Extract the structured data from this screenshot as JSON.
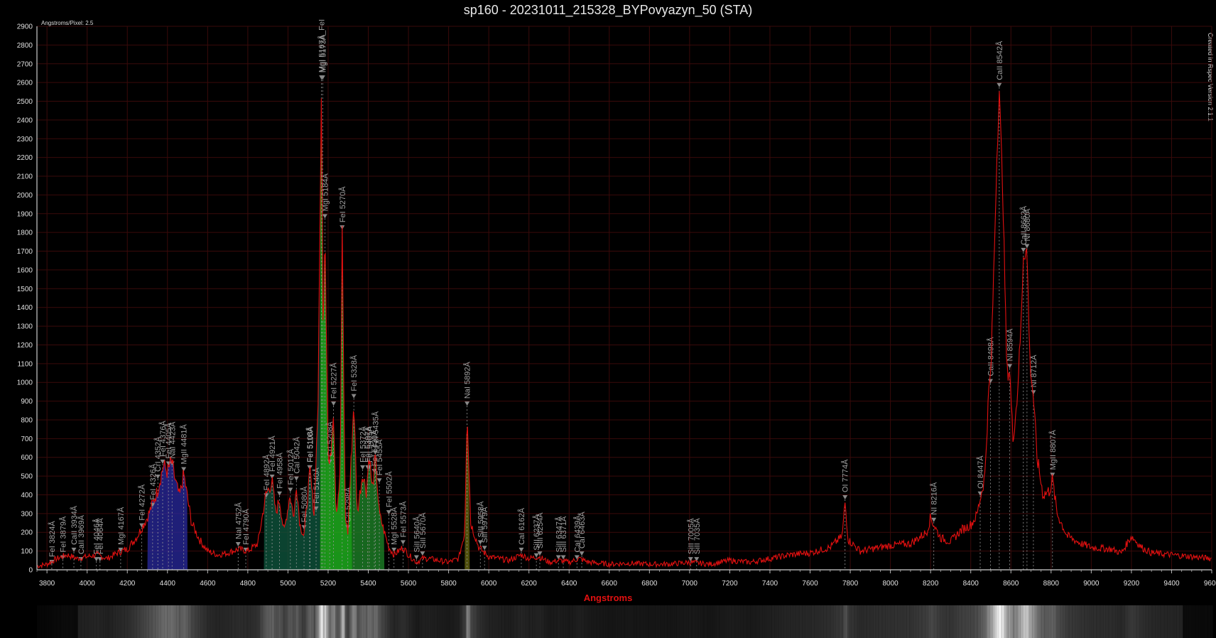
{
  "window": {
    "title": "sp160 - 20231011_215328_BYPovyazyn_50 (STA)",
    "angstroms_per_pixel": "Angstroms/Pixel: 2.5",
    "credit": "Created in Rspec Version 2.1.1"
  },
  "colors": {
    "background": "#000000",
    "grid": "#3a0a0a",
    "line": "#e21010",
    "marker": "#888888",
    "label": "#a0a0a0",
    "axis_label": "#e21010"
  },
  "chart_data": {
    "type": "line",
    "title": "sp160 - 20231011_215328_BYPovyazyn_50 (STA)",
    "xlabel": "Angstroms",
    "ylabel": "",
    "xlim": [
      3750,
      9600
    ],
    "ylim": [
      0,
      2900
    ],
    "x_ticks": [
      3800,
      4000,
      4200,
      4400,
      4600,
      4800,
      5000,
      5200,
      5400,
      5600,
      5800,
      6000,
      6200,
      6400,
      6600,
      6800,
      7000,
      7200,
      7400,
      7600,
      7800,
      8000,
      8200,
      8400,
      8600,
      8800,
      9000,
      9200,
      9400,
      9600
    ],
    "y_ticks": [
      0,
      100,
      200,
      300,
      400,
      500,
      600,
      700,
      800,
      900,
      1000,
      1100,
      1200,
      1300,
      1400,
      1500,
      1600,
      1700,
      1800,
      1900,
      2000,
      2100,
      2200,
      2300,
      2400,
      2500,
      2600,
      2700,
      2800,
      2900
    ],
    "grid": true,
    "series": [
      {
        "values": [
          [
            3750,
            20
          ],
          [
            3800,
            30
          ],
          [
            3850,
            60
          ],
          [
            3900,
            80
          ],
          [
            3950,
            60
          ],
          [
            4000,
            70
          ],
          [
            4050,
            80
          ],
          [
            4100,
            60
          ],
          [
            4150,
            90
          ],
          [
            4200,
            110
          ],
          [
            4250,
            180
          ],
          [
            4300,
            280
          ],
          [
            4350,
            420
          ],
          [
            4380,
            560
          ],
          [
            4400,
            520
          ],
          [
            4420,
            580
          ],
          [
            4440,
            470
          ],
          [
            4460,
            390
          ],
          [
            4481,
            510
          ],
          [
            4520,
            250
          ],
          [
            4560,
            160
          ],
          [
            4600,
            100
          ],
          [
            4650,
            80
          ],
          [
            4700,
            90
          ],
          [
            4752,
            110
          ],
          [
            4800,
            100
          ],
          [
            4850,
            140
          ],
          [
            4890,
            400
          ],
          [
            4921,
            470
          ],
          [
            4940,
            300
          ],
          [
            4957,
            380
          ],
          [
            4980,
            200
          ],
          [
            5010,
            400
          ],
          [
            5030,
            280
          ],
          [
            5042,
            460
          ],
          [
            5060,
            240
          ],
          [
            5080,
            180
          ],
          [
            5100,
            420
          ],
          [
            5110,
            520
          ],
          [
            5130,
            300
          ],
          [
            5150,
            900
          ],
          [
            5167,
            2600
          ],
          [
            5175,
            1200
          ],
          [
            5184,
            1860
          ],
          [
            5200,
            600
          ],
          [
            5208,
            550
          ],
          [
            5227,
            860
          ],
          [
            5240,
            300
          ],
          [
            5260,
            500
          ],
          [
            5270,
            1800
          ],
          [
            5285,
            300
          ],
          [
            5298,
            200
          ],
          [
            5328,
            900
          ],
          [
            5345,
            300
          ],
          [
            5372,
            520
          ],
          [
            5390,
            420
          ],
          [
            5405,
            620
          ],
          [
            5420,
            420
          ],
          [
            5435,
            600
          ],
          [
            5455,
            300
          ],
          [
            5480,
            200
          ],
          [
            5502,
            120
          ],
          [
            5528,
            80
          ],
          [
            5573,
            120
          ],
          [
            5600,
            80
          ],
          [
            5640,
            40
          ],
          [
            5670,
            60
          ],
          [
            5700,
            60
          ],
          [
            5750,
            50
          ],
          [
            5800,
            40
          ],
          [
            5850,
            60
          ],
          [
            5880,
            200
          ],
          [
            5892,
            860
          ],
          [
            5900,
            600
          ],
          [
            5910,
            250
          ],
          [
            5950,
            120
          ],
          [
            5979,
            90
          ],
          [
            6000,
            70
          ],
          [
            6050,
            60
          ],
          [
            6100,
            50
          ],
          [
            6162,
            80
          ],
          [
            6200,
            60
          ],
          [
            6250,
            70
          ],
          [
            6300,
            40
          ],
          [
            6350,
            50
          ],
          [
            6400,
            40
          ],
          [
            6450,
            60
          ],
          [
            6500,
            40
          ],
          [
            6600,
            30
          ],
          [
            6700,
            35
          ],
          [
            6800,
            30
          ],
          [
            6900,
            30
          ],
          [
            7000,
            40
          ],
          [
            7100,
            30
          ],
          [
            7200,
            50
          ],
          [
            7300,
            40
          ],
          [
            7400,
            60
          ],
          [
            7500,
            80
          ],
          [
            7600,
            90
          ],
          [
            7700,
            120
          ],
          [
            7760,
            180
          ],
          [
            7774,
            360
          ],
          [
            7790,
            160
          ],
          [
            7850,
            100
          ],
          [
            7900,
            110
          ],
          [
            8000,
            130
          ],
          [
            8100,
            140
          ],
          [
            8180,
            200
          ],
          [
            8200,
            280
          ],
          [
            8216,
            240
          ],
          [
            8250,
            170
          ],
          [
            8300,
            150
          ],
          [
            8350,
            210
          ],
          [
            8400,
            240
          ],
          [
            8430,
            290
          ],
          [
            8447,
            380
          ],
          [
            8470,
            500
          ],
          [
            8490,
            960
          ],
          [
            8500,
            1050
          ],
          [
            8520,
            1800
          ],
          [
            8530,
            2200
          ],
          [
            8542,
            2560
          ],
          [
            8560,
            2000
          ],
          [
            8580,
            1050
          ],
          [
            8594,
            1060
          ],
          [
            8610,
            700
          ],
          [
            8630,
            900
          ],
          [
            8650,
            1300
          ],
          [
            8662,
            1680
          ],
          [
            8675,
            1700
          ],
          [
            8680,
            1700
          ],
          [
            8695,
            1100
          ],
          [
            8712,
            920
          ],
          [
            8730,
            600
          ],
          [
            8760,
            400
          ],
          [
            8790,
            420
          ],
          [
            8807,
            480
          ],
          [
            8830,
            300
          ],
          [
            8880,
            180
          ],
          [
            8950,
            140
          ],
          [
            9000,
            120
          ],
          [
            9100,
            110
          ],
          [
            9150,
            90
          ],
          [
            9200,
            180
          ],
          [
            9250,
            120
          ],
          [
            9300,
            90
          ],
          [
            9400,
            80
          ],
          [
            9500,
            70
          ],
          [
            9600,
            60
          ]
        ]
      }
    ],
    "annotations": [
      {
        "label": "FeI 3824Å",
        "x": 3824,
        "y": 15
      },
      {
        "label": "FeI 3879Å",
        "x": 3879,
        "y": 40
      },
      {
        "label": "CaII 3934Å",
        "x": 3934,
        "y": 80
      },
      {
        "label": "CaII 3969Å",
        "x": 3969,
        "y": 30
      },
      {
        "label": "FeI 4046Å",
        "x": 4046,
        "y": 30
      },
      {
        "label": "FeI 4064Å",
        "x": 4064,
        "y": 30
      },
      {
        "label": "MgI 4167Å",
        "x": 4167,
        "y": 80
      },
      {
        "label": "FeI 4272Å",
        "x": 4272,
        "y": 210
      },
      {
        "label": "FeI 4326Å",
        "x": 4326,
        "y": 320
      },
      {
        "label": "CrI 4352Å",
        "x": 4352,
        "y": 470
      },
      {
        "label": "FeI 4376Å",
        "x": 4376,
        "y": 550
      },
      {
        "label": "FeI 4405Å",
        "x": 4405,
        "y": 540
      },
      {
        "label": "NaI 4423Å",
        "x": 4423,
        "y": 540
      },
      {
        "label": "MgII 4481Å",
        "x": 4481,
        "y": 510
      },
      {
        "label": "NaI 4752Å",
        "x": 4752,
        "y": 110
      },
      {
        "label": "FeI 4790Å",
        "x": 4790,
        "y": 80
      },
      {
        "label": "FeI 4892Å",
        "x": 4892,
        "y": 370
      },
      {
        "label": "FeI 4921Å",
        "x": 4921,
        "y": 470
      },
      {
        "label": "FeI 4958Å",
        "x": 4958,
        "y": 380
      },
      {
        "label": "FeI 5012Å",
        "x": 5012,
        "y": 400
      },
      {
        "label": "CaI 5042Å",
        "x": 5042,
        "y": 460
      },
      {
        "label": "FeI 5080Å",
        "x": 5080,
        "y": 200
      },
      {
        "label": "FeI 5108Å",
        "x": 5108,
        "y": 520
      },
      {
        "label": "FeI 5110Å",
        "x": 5110,
        "y": 520
      },
      {
        "label": "FeI 5140Å",
        "x": 5140,
        "y": 300
      },
      {
        "label": "MgI 5167Å_FeI",
        "x": 5167,
        "y": 2600
      },
      {
        "label": "MgI 5173Å",
        "x": 5173,
        "y": 2600
      },
      {
        "label": "MgI 5184Å",
        "x": 5184,
        "y": 1860
      },
      {
        "label": "CrI 5208Å",
        "x": 5208,
        "y": 550
      },
      {
        "label": "FeI 5227Å",
        "x": 5227,
        "y": 860
      },
      {
        "label": "FeI 5270Å",
        "x": 5270,
        "y": 1800
      },
      {
        "label": "CrI 5298Å",
        "x": 5298,
        "y": 200
      },
      {
        "label": "FeI 5328Å",
        "x": 5328,
        "y": 900
      },
      {
        "label": "FeI 5372Å",
        "x": 5372,
        "y": 520
      },
      {
        "label": "FeI 5397Å",
        "x": 5397,
        "y": 520
      },
      {
        "label": "FeI 5405Å",
        "x": 5405,
        "y": 520
      },
      {
        "label": "FeI 5430Å",
        "x": 5430,
        "y": 500
      },
      {
        "label": "FeI 5435Å",
        "x": 5435,
        "y": 600
      },
      {
        "label": "FeI 5455Å",
        "x": 5455,
        "y": 450
      },
      {
        "label": "FeI 5502Å",
        "x": 5502,
        "y": 280
      },
      {
        "label": "MgI 5528Å",
        "x": 5528,
        "y": 80
      },
      {
        "label": "FeI 5573Å",
        "x": 5573,
        "y": 120
      },
      {
        "label": "SiII 5640Å",
        "x": 5640,
        "y": 40
      },
      {
        "label": "SiII 5670Å",
        "x": 5670,
        "y": 60
      },
      {
        "label": "NaI 5892Å",
        "x": 5892,
        "y": 860
      },
      {
        "label": "SiII 5958Å",
        "x": 5958,
        "y": 120
      },
      {
        "label": "SiII 5979Å",
        "x": 5979,
        "y": 90
      },
      {
        "label": "CaI 6162Å",
        "x": 6162,
        "y": 80
      },
      {
        "label": "SiII 6237Å",
        "x": 6237,
        "y": 50
      },
      {
        "label": "SiII 6254Å",
        "x": 6254,
        "y": 60
      },
      {
        "label": "SiII 6347Å",
        "x": 6347,
        "y": 40
      },
      {
        "label": "SiII 6371Å",
        "x": 6371,
        "y": 40
      },
      {
        "label": "CaI 6439Å",
        "x": 6439,
        "y": 40
      },
      {
        "label": "CaI 6463Å",
        "x": 6463,
        "y": 60
      },
      {
        "label": "SiII 7005Å",
        "x": 7005,
        "y": 30
      },
      {
        "label": "SiII 7035Å",
        "x": 7035,
        "y": 30
      },
      {
        "label": "OI 7774Å",
        "x": 7774,
        "y": 360
      },
      {
        "label": "NI 8216Å",
        "x": 8216,
        "y": 240
      },
      {
        "label": "OI 8447Å",
        "x": 8447,
        "y": 380
      },
      {
        "label": "CaII 8498Å",
        "x": 8498,
        "y": 980
      },
      {
        "label": "CaII 8542Å",
        "x": 8542,
        "y": 2560
      },
      {
        "label": "NI 8594Å",
        "x": 8594,
        "y": 1060
      },
      {
        "label": "CaII 8662Å",
        "x": 8662,
        "y": 1680
      },
      {
        "label": "NI 8680Å",
        "x": 8680,
        "y": 1700
      },
      {
        "label": "NI 8712Å",
        "x": 8712,
        "y": 920
      },
      {
        "label": "MgII 8807Å",
        "x": 8807,
        "y": 480
      }
    ],
    "spectrum_strip_peaks": [
      5170,
      5270,
      5892,
      8498,
      8542,
      8662
    ]
  }
}
